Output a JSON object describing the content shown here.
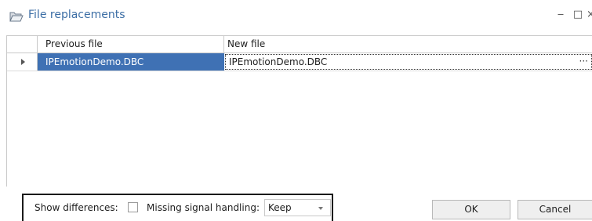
{
  "window": {
    "title": "File replacements",
    "minimize_glyph": "‒",
    "maximize_glyph": "□",
    "close_glyph": "×"
  },
  "grid": {
    "columns": [
      "Previous file",
      "New file"
    ],
    "rows": [
      {
        "previous": "IPEmotionDemo.DBC",
        "new": "IPEmotionDemo.DBC",
        "ellipsis": "···"
      }
    ]
  },
  "options": {
    "show_differences_label": "Show differences:",
    "show_differences_checked": false,
    "missing_signal_label": "Missing signal handling:",
    "missing_signal_value": "Keep"
  },
  "buttons": {
    "ok": "OK",
    "cancel": "Cancel"
  },
  "colors": {
    "title": "#3c6ea5",
    "selected_cell": "#3f71b4"
  },
  "icons": {
    "title_icon": "folder-open-icon"
  }
}
